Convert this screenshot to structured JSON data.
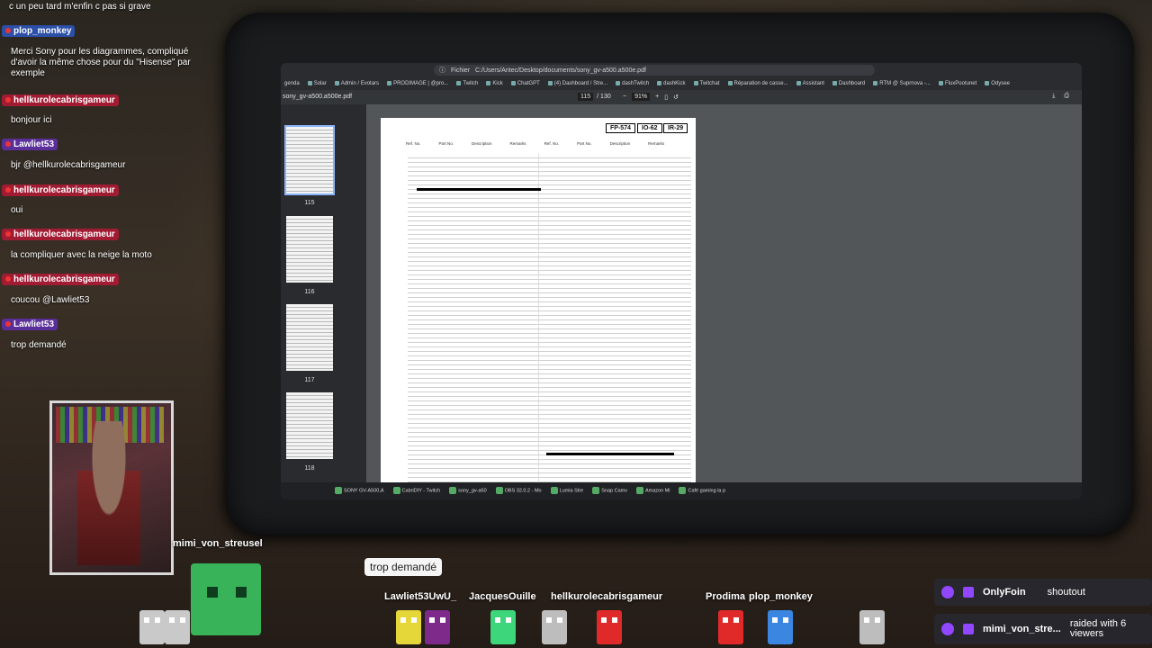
{
  "chat": {
    "messages": [
      {
        "user": "",
        "text": "c un peu tard m'enfin c pas si grave",
        "color": "none"
      },
      {
        "user": "plop_monkey",
        "text": "Merci Sony pour les diagrammes, compliqué d'avoir la même chose pour du \"Hisense\" par exemple",
        "color": "blue"
      },
      {
        "user": "hellkurolecabrisgameur",
        "text": "bonjour ici",
        "color": "red"
      },
      {
        "user": "Lawliet53",
        "text": "bjr @hellkurolecabrisgameur",
        "color": "purple"
      },
      {
        "user": "hellkurolecabrisgameur",
        "text": "oui",
        "color": "red"
      },
      {
        "user": "hellkurolecabrisgameur",
        "text": "la compliquer avec la neige la moto",
        "color": "red"
      },
      {
        "user": "hellkurolecabrisgameur",
        "text": "coucou @Lawliet53",
        "color": "red"
      },
      {
        "user": "Lawliet53",
        "text": "trop demandé",
        "color": "purple"
      }
    ]
  },
  "browser": {
    "address_prefix": "Fichier",
    "address": "C:/Users/Antec/Desktop/documents/sony_gv-a500.a500e.pdf",
    "bookmarks": [
      "genda",
      "Solar",
      "Admin / Evotars",
      "PRODIMAGE | @pro...",
      "Twitch",
      "Kick",
      "ChatGPT",
      "(4) Dashboard / Stre...",
      "dashTwitch",
      "dashKick",
      "Twitchat",
      "Réparation de casse...",
      "Assistant",
      "Dashboard",
      "RTM @ Suprnova -...",
      "FluxPootunet",
      "Odysee"
    ]
  },
  "pdf": {
    "filename": "sony_gv-a500.a500e.pdf",
    "current_page": "115",
    "total_pages": "/ 130",
    "zoom": "91%",
    "thumbnails": [
      "115",
      "116",
      "117",
      "118"
    ],
    "page_marks": [
      "FP-574",
      "IO-62",
      "IR-29"
    ],
    "col_headers": [
      "Ref. No.",
      "Part No.",
      "Description",
      "Remarks",
      "Ref. No.",
      "Part No.",
      "Description",
      "Remarks"
    ]
  },
  "taskbar": {
    "items": [
      "SONY GV-A500,A",
      "CabriDIY - Twitch",
      "sony_gv-a50",
      "OBS 32.0.2 - Mo",
      "Lumia Stre",
      "Snap Camv",
      "Amazon Mi",
      "Café gaming la p"
    ]
  },
  "overlay": {
    "webcam_name": "mimi_von_streusel",
    "bubble": "trop demandé",
    "names": [
      "Lawliet53UwU_",
      "JacquesOuille",
      "hellkurolecabrisgameur",
      "Prodima",
      "plop_monkey"
    ]
  },
  "alerts": [
    {
      "name": "OnlyFoin",
      "action": "shoutout"
    },
    {
      "name": "mimi_von_stre...",
      "action": "raided with 6 viewers"
    }
  ],
  "colors": {
    "red_badge": "#a11b33",
    "purple_badge": "#5a2f9a",
    "blue_badge": "#2c4fa8",
    "twitch": "#9147ff",
    "avatar_green": "#38b35a"
  }
}
